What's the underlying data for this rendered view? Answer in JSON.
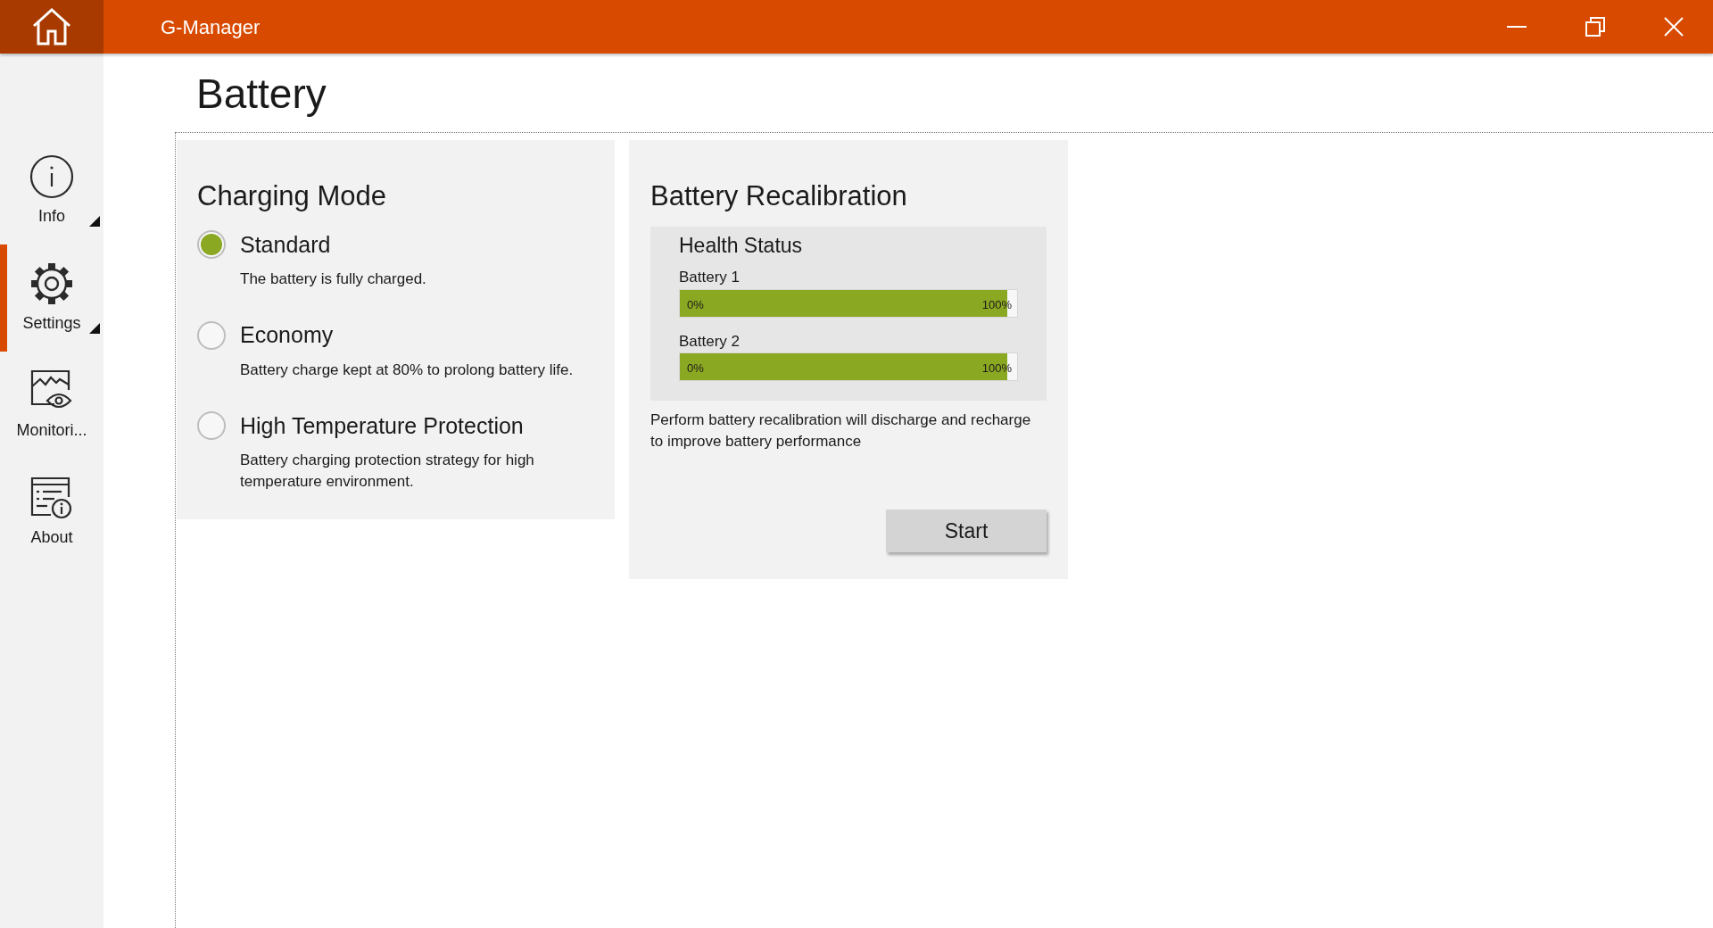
{
  "window": {
    "title": "G-Manager"
  },
  "sidebar": {
    "items": [
      {
        "label": "Info",
        "selected": false,
        "has_submenu": true
      },
      {
        "label": "Settings",
        "selected": true,
        "has_submenu": true
      },
      {
        "label": "Monitori...",
        "selected": false,
        "has_submenu": false
      },
      {
        "label": "About",
        "selected": false,
        "has_submenu": false
      }
    ]
  },
  "page": {
    "title": "Battery"
  },
  "charging_mode": {
    "title": "Charging Mode",
    "options": [
      {
        "label": "Standard",
        "description": "The battery is fully charged.",
        "selected": true
      },
      {
        "label": "Economy",
        "description": "Battery charge kept at 80% to prolong battery life.",
        "selected": false
      },
      {
        "label": "High Temperature Protection",
        "description": "Battery charging protection strategy for high temperature environment.",
        "selected": false
      }
    ]
  },
  "recalibration": {
    "title": "Battery Recalibration",
    "health_title": "Health Status",
    "batteries": [
      {
        "name": "Battery 1",
        "level": 0.97,
        "min_label": "0%",
        "max_label": "100%"
      },
      {
        "name": "Battery 2",
        "level": 0.97,
        "min_label": "0%",
        "max_label": "100%"
      }
    ],
    "description": "Perform battery recalibration will discharge and recharge to improve battery performance",
    "button": "Start"
  }
}
